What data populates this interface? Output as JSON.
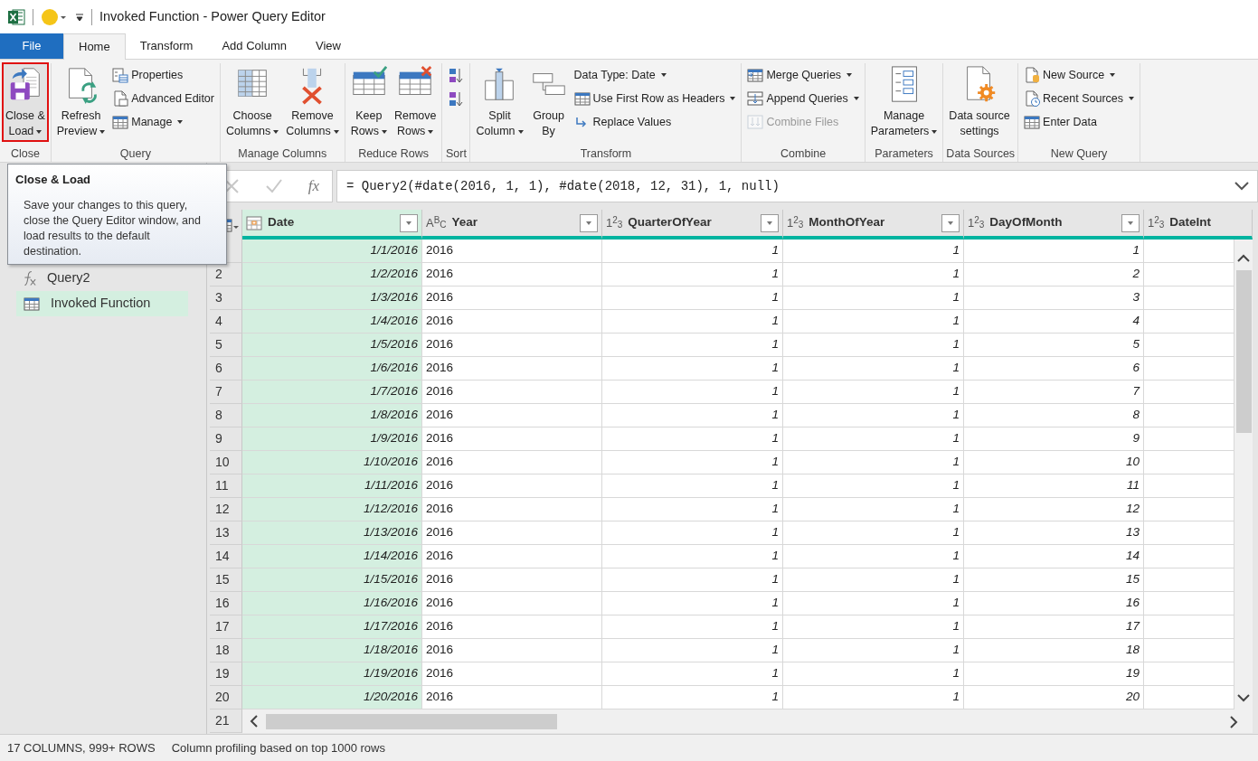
{
  "window": {
    "title": "Invoked Function - Power Query Editor"
  },
  "tabs": [
    {
      "label": "File",
      "kind": "file",
      "selected": false
    },
    {
      "label": "Home",
      "kind": "tab",
      "selected": true
    },
    {
      "label": "Transform",
      "kind": "tab",
      "selected": false
    },
    {
      "label": "Add Column",
      "kind": "tab",
      "selected": false
    },
    {
      "label": "View",
      "kind": "tab",
      "selected": false
    }
  ],
  "ribbon": [
    {
      "label": "Close",
      "items": [
        {
          "kind": "large",
          "label": "Close &\nLoad",
          "dropdown": true,
          "highlighted": true
        }
      ]
    },
    {
      "label": "Query",
      "items": [
        {
          "kind": "large",
          "label": "Refresh\nPreview",
          "dropdown": true
        },
        {
          "kind": "stack",
          "buttons": [
            {
              "label": "Properties",
              "dropdown": false,
              "disabled": false
            },
            {
              "label": "Advanced Editor",
              "dropdown": false,
              "disabled": false
            },
            {
              "label": "Manage",
              "dropdown": true,
              "disabled": false
            }
          ]
        }
      ]
    },
    {
      "label": "Manage Columns",
      "items": [
        {
          "kind": "large",
          "label": "Choose\nColumns",
          "dropdown": true
        },
        {
          "kind": "large",
          "label": "Remove\nColumns",
          "dropdown": true
        }
      ]
    },
    {
      "label": "Reduce Rows",
      "items": [
        {
          "kind": "large",
          "label": "Keep\nRows",
          "dropdown": true
        },
        {
          "kind": "large",
          "label": "Remove\nRows",
          "dropdown": true
        }
      ]
    },
    {
      "label": "Sort",
      "items": [
        {
          "kind": "stack",
          "buttons": [
            {
              "dropdown": false,
              "disabled": false
            },
            {
              "dropdown": false,
              "disabled": false
            }
          ]
        }
      ]
    },
    {
      "label": "Transform",
      "items": [
        {
          "kind": "large",
          "label": "Split\nColumn",
          "dropdown": true
        },
        {
          "kind": "large",
          "label": "Group\nBy",
          "dropdown": false
        },
        {
          "kind": "stack",
          "buttons": [
            {
              "label": "Data Type: Date",
              "dropdown": true,
              "disabled": false
            },
            {
              "label": "Use First Row as Headers",
              "dropdown": true,
              "disabled": false
            },
            {
              "label": "Replace Values",
              "dropdown": false,
              "disabled": false
            }
          ]
        }
      ]
    },
    {
      "label": "Combine",
      "items": [
        {
          "kind": "stack",
          "buttons": [
            {
              "label": "Merge Queries",
              "dropdown": true,
              "disabled": false
            },
            {
              "label": "Append Queries",
              "dropdown": true,
              "disabled": false
            },
            {
              "label": "Combine Files",
              "dropdown": false,
              "disabled": true
            }
          ]
        }
      ]
    },
    {
      "label": "Parameters",
      "items": [
        {
          "kind": "large",
          "label": "Manage\nParameters",
          "dropdown": true
        }
      ]
    },
    {
      "label": "Data Sources",
      "items": [
        {
          "kind": "large",
          "label": "Data source\nsettings",
          "dropdown": false
        }
      ]
    },
    {
      "label": "New Query",
      "items": [
        {
          "kind": "stack",
          "buttons": [
            {
              "label": "New Source",
              "dropdown": true,
              "disabled": false
            },
            {
              "label": "Recent Sources",
              "dropdown": true,
              "disabled": false
            },
            {
              "label": "Enter Data",
              "dropdown": false,
              "disabled": false
            }
          ]
        }
      ]
    }
  ],
  "tooltip": {
    "title": "Close & Load",
    "text": "Save your changes to this query, close the Query Editor window, and load results to the default destination."
  },
  "sidebar": {
    "items": [
      {
        "label": "Query2",
        "kind": "function",
        "selected": false
      },
      {
        "label": "Invoked Function",
        "kind": "table",
        "selected": true
      }
    ]
  },
  "formula_bar": {
    "fx_label": "fx",
    "formula": "= Query2(#date(2016, 1, 1), #date(2018, 12, 31), 1, null)"
  },
  "table": {
    "columns": [
      {
        "name": "Date",
        "kind": "date",
        "selected": true,
        "filter": true
      },
      {
        "name": "Year",
        "kind": "text",
        "type_label": "A$^{B}$$_{C}$",
        "selected": false,
        "filter": true
      },
      {
        "name": "QuarterOfYear",
        "kind": "number",
        "type_label": "1$^{2}$$_{3}$",
        "selected": false,
        "filter": true
      },
      {
        "name": "MonthOfYear",
        "kind": "number",
        "type_label": "1$^{2}$$_{3}$",
        "selected": false,
        "filter": true
      },
      {
        "name": "DayOfMonth",
        "kind": "number",
        "type_label": "1$^{2}$$_{3}$",
        "selected": false,
        "filter": true
      },
      {
        "name": "DateInt",
        "kind": "number",
        "type_label": "1$^{2}$$_{3}$",
        "selected": false,
        "filter": false
      }
    ],
    "rows": [
      {
        "cells": [
          "1/1/2016",
          "2016",
          "1",
          "1",
          "1"
        ]
      },
      {
        "num": "2",
        "cells": [
          "1/2/2016",
          "2016",
          "1",
          "1",
          "2"
        ]
      },
      {
        "num": "3",
        "cells": [
          "1/3/2016",
          "2016",
          "1",
          "1",
          "3"
        ]
      },
      {
        "num": "4",
        "cells": [
          "1/4/2016",
          "2016",
          "1",
          "1",
          "4"
        ]
      },
      {
        "num": "5",
        "cells": [
          "1/5/2016",
          "2016",
          "1",
          "1",
          "5"
        ]
      },
      {
        "num": "6",
        "cells": [
          "1/6/2016",
          "2016",
          "1",
          "1",
          "6"
        ]
      },
      {
        "num": "7",
        "cells": [
          "1/7/2016",
          "2016",
          "1",
          "1",
          "7"
        ]
      },
      {
        "num": "8",
        "cells": [
          "1/8/2016",
          "2016",
          "1",
          "1",
          "8"
        ]
      },
      {
        "num": "9",
        "cells": [
          "1/9/2016",
          "2016",
          "1",
          "1",
          "9"
        ]
      },
      {
        "num": "10",
        "cells": [
          "1/10/2016",
          "2016",
          "1",
          "1",
          "10"
        ]
      },
      {
        "num": "11",
        "cells": [
          "1/11/2016",
          "2016",
          "1",
          "1",
          "11"
        ]
      },
      {
        "num": "12",
        "cells": [
          "1/12/2016",
          "2016",
          "1",
          "1",
          "12"
        ]
      },
      {
        "num": "13",
        "cells": [
          "1/13/2016",
          "2016",
          "1",
          "1",
          "13"
        ]
      },
      {
        "num": "14",
        "cells": [
          "1/14/2016",
          "2016",
          "1",
          "1",
          "14"
        ]
      },
      {
        "num": "15",
        "cells": [
          "1/15/2016",
          "2016",
          "1",
          "1",
          "15"
        ]
      },
      {
        "num": "16",
        "cells": [
          "1/16/2016",
          "2016",
          "1",
          "1",
          "16"
        ]
      },
      {
        "num": "17",
        "cells": [
          "1/17/2016",
          "2016",
          "1",
          "1",
          "17"
        ]
      },
      {
        "num": "18",
        "cells": [
          "1/18/2016",
          "2016",
          "1",
          "1",
          "18"
        ]
      },
      {
        "num": "19",
        "cells": [
          "1/19/2016",
          "2016",
          "1",
          "1",
          "19"
        ]
      },
      {
        "num": "20",
        "cells": [
          "1/20/2016",
          "2016",
          "1",
          "1",
          "20"
        ]
      }
    ],
    "last_row_number": "21"
  },
  "status_bar": {
    "columns_rows": "17 COLUMNS, 999+ ROWS",
    "profiling": "Column profiling based on top 1000 rows"
  }
}
